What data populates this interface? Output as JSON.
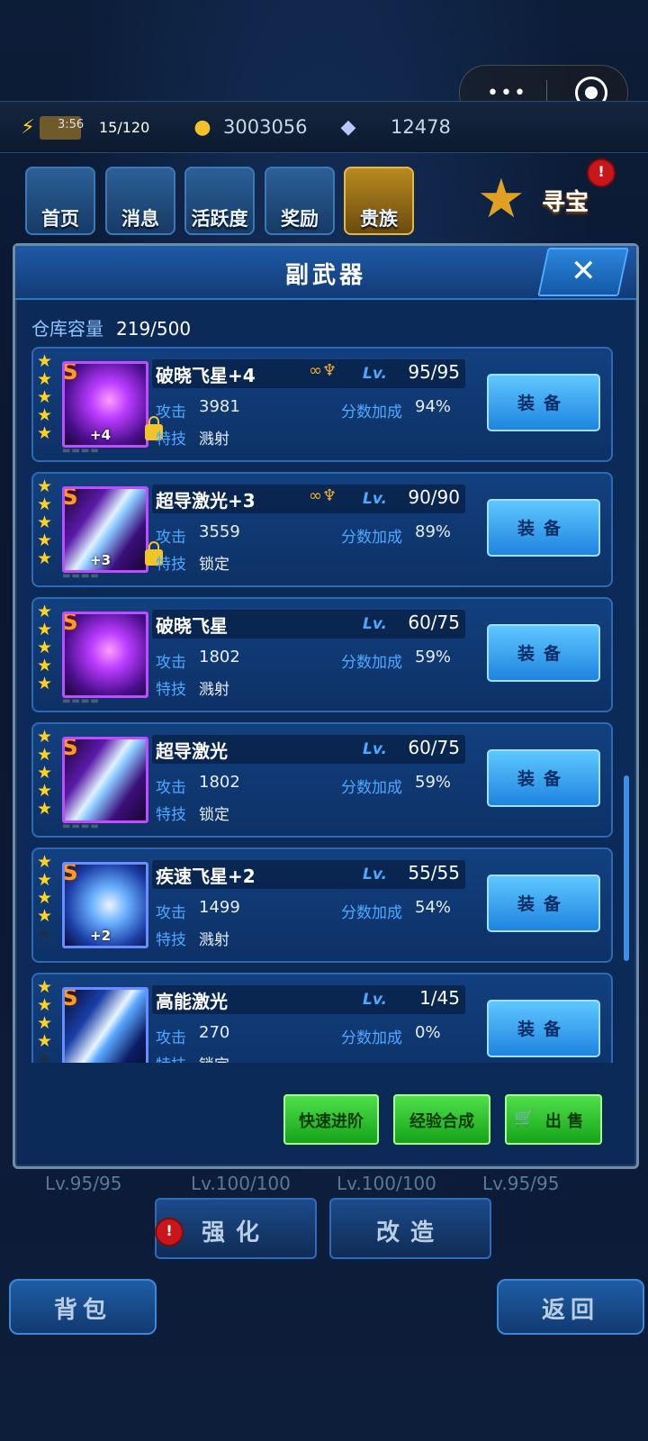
{
  "resources": {
    "energy_timer": "3:56",
    "energy": "15/120",
    "coins": "3003056",
    "gems": "12478"
  },
  "nav": [
    {
      "label": "首页",
      "icon": "home-icon"
    },
    {
      "label": "消息",
      "icon": "mail-icon"
    },
    {
      "label": "活跃度",
      "icon": "activity-icon"
    },
    {
      "label": "奖励",
      "icon": "gift-icon"
    },
    {
      "label": "贵族",
      "icon": "noble-icon"
    }
  ],
  "treasure": {
    "label": "寻宝",
    "badge": "!"
  },
  "modal": {
    "title": "副武器",
    "close": "✕",
    "capacity_label": "仓库容量",
    "capacity_value": "219/500"
  },
  "items": [
    {
      "name": "破晓飞星+4",
      "lv_tag": "Lv.",
      "level": "95/95",
      "attack_label": "攻击",
      "attack": "3981",
      "bonus_label": "分数加成",
      "bonus": "94%",
      "skill_label": "特技",
      "skill": "溅射",
      "plus": "+4",
      "equip": "装备",
      "stars": 5,
      "locked": true,
      "awakened": true
    },
    {
      "name": "超导激光+3",
      "lv_tag": "Lv.",
      "level": "90/90",
      "attack_label": "攻击",
      "attack": "3559",
      "bonus_label": "分数加成",
      "bonus": "89%",
      "skill_label": "特技",
      "skill": "锁定",
      "plus": "+3",
      "equip": "装备",
      "stars": 5,
      "locked": true,
      "awakened": true
    },
    {
      "name": "破晓飞星",
      "lv_tag": "Lv.",
      "level": "60/75",
      "attack_label": "攻击",
      "attack": "1802",
      "bonus_label": "分数加成",
      "bonus": "59%",
      "skill_label": "特技",
      "skill": "溅射",
      "plus": "",
      "equip": "装备",
      "stars": 5,
      "locked": false,
      "awakened": false
    },
    {
      "name": "超导激光",
      "lv_tag": "Lv.",
      "level": "60/75",
      "attack_label": "攻击",
      "attack": "1802",
      "bonus_label": "分数加成",
      "bonus": "59%",
      "skill_label": "特技",
      "skill": "锁定",
      "plus": "",
      "equip": "装备",
      "stars": 5,
      "locked": false,
      "awakened": false
    },
    {
      "name": "疾速飞星+2",
      "lv_tag": "Lv.",
      "level": "55/55",
      "attack_label": "攻击",
      "attack": "1499",
      "bonus_label": "分数加成",
      "bonus": "54%",
      "skill_label": "特技",
      "skill": "溅射",
      "plus": "+2",
      "equip": "装备",
      "stars": 4,
      "locked": false,
      "awakened": false
    },
    {
      "name": "高能激光",
      "lv_tag": "Lv.",
      "level": "1/45",
      "attack_label": "攻击",
      "attack": "270",
      "bonus_label": "分数加成",
      "bonus": "0%",
      "skill_label": "特技",
      "skill": "锁定",
      "plus": "",
      "equip": "装备",
      "stars": 4,
      "locked": false,
      "awakened": false
    }
  ],
  "actions": {
    "fast_advance": "快速进阶",
    "exp_merge": "经验合成",
    "sell": "出 售"
  },
  "bottom": {
    "levels": [
      "Lv.95/95",
      "Lv.100/100",
      "Lv.100/100",
      "Lv.95/95"
    ],
    "strengthen": "强化",
    "modify": "改造",
    "bag": "背包",
    "back": "返回",
    "badge": "!"
  }
}
